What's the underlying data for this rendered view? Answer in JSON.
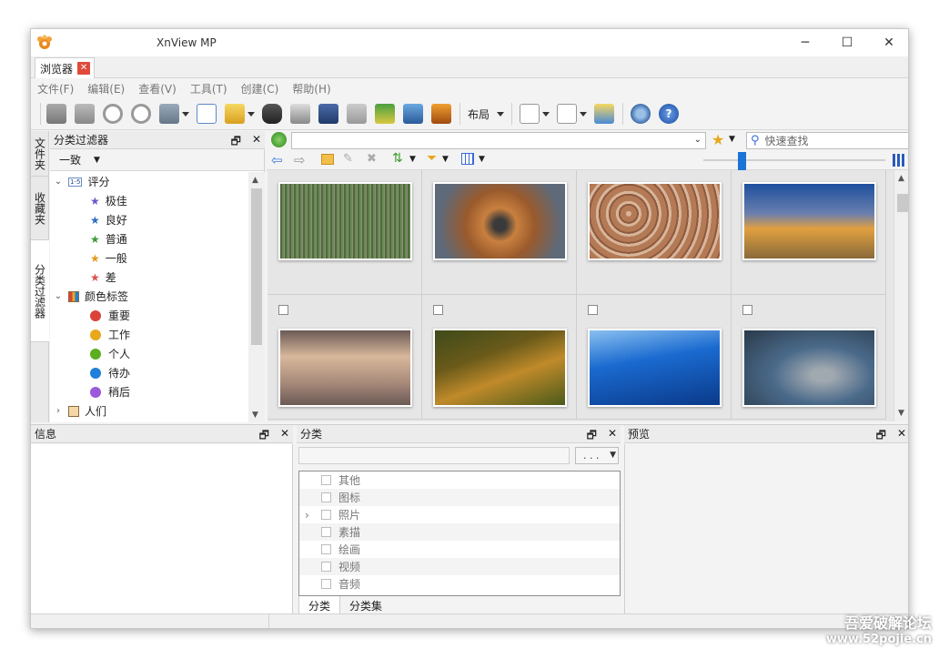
{
  "window": {
    "title": "XnView MP",
    "controls": {
      "minimize": "─",
      "maximize": "☐",
      "close": "✕"
    }
  },
  "tab": {
    "label": "浏览器",
    "close": "✕"
  },
  "menu": [
    {
      "label": "文件(F)"
    },
    {
      "label": "编辑(E)"
    },
    {
      "label": "查看(V)"
    },
    {
      "label": "工具(T)"
    },
    {
      "label": "创建(C)"
    },
    {
      "label": "帮助(H)"
    }
  ],
  "toolbar": {
    "layout_label": "布局"
  },
  "vtabs": {
    "folders": "文件夹",
    "favorites": "收藏夹",
    "filter": "分类过滤器"
  },
  "filter_panel": {
    "title": "分类过滤器",
    "float": "🗗",
    "close": "✕",
    "mode": "一致",
    "tree": {
      "rating": {
        "label": "评分",
        "icon_text": "1-5",
        "items": [
          {
            "label": "极佳",
            "color": "#6a5acd"
          },
          {
            "label": "良好",
            "color": "#2f6fc2"
          },
          {
            "label": "普通",
            "color": "#3a9a3a"
          },
          {
            "label": "一般",
            "color": "#e69a1e"
          },
          {
            "label": "差",
            "color": "#d9534f"
          }
        ]
      },
      "color_labels": {
        "label": "颜色标签",
        "items": [
          {
            "label": "重要",
            "color": "#d9433a"
          },
          {
            "label": "工作",
            "color": "#e8a81c"
          },
          {
            "label": "个人",
            "color": "#5cae1f"
          },
          {
            "label": "待办",
            "color": "#1f7fd9"
          },
          {
            "label": "稍后",
            "color": "#9a5ad9"
          }
        ]
      },
      "people": {
        "label": "人们"
      }
    }
  },
  "search": {
    "placeholder": "快速查找"
  },
  "thumbnails": [
    {
      "name": "grass-field",
      "colors": [
        "#5b7a4a",
        "#8f8a7a",
        "#4e6b3b"
      ]
    },
    {
      "name": "bat-eared-fox",
      "colors": [
        "#c9803f",
        "#5e6a7a",
        "#9a5a2c"
      ]
    },
    {
      "name": "cracked-clay",
      "colors": [
        "#b37a55",
        "#d8b59a",
        "#8e5a3e"
      ]
    },
    {
      "name": "brooklyn-bridge",
      "colors": [
        "#1f4f9e",
        "#e0a040",
        "#6a7fae"
      ]
    },
    {
      "name": "beach-sunset",
      "colors": [
        "#d8b89c",
        "#6b5a55",
        "#a88a7a"
      ]
    },
    {
      "name": "vineyard-hills",
      "colors": [
        "#6a5a1a",
        "#c08a2a",
        "#3e4a1a"
      ]
    },
    {
      "name": "blue-ice-cave",
      "colors": [
        "#1a6ad0",
        "#8ac0f0",
        "#0a3a8a"
      ]
    },
    {
      "name": "deer-in-snow",
      "colors": [
        "#4a6a8a",
        "#a0a8b0",
        "#2a3a4a"
      ]
    }
  ],
  "info_panel": {
    "title": "信息",
    "float": "🗗",
    "close": "✕"
  },
  "category_panel": {
    "title": "分类",
    "float": "🗗",
    "close": "✕",
    "dots": ". . .",
    "items": [
      {
        "label": "其他"
      },
      {
        "label": "图标"
      },
      {
        "label": "照片",
        "expandable": true
      },
      {
        "label": "素描"
      },
      {
        "label": "绘画"
      },
      {
        "label": "视频"
      },
      {
        "label": "音频"
      }
    ],
    "tabs": {
      "category": "分类",
      "category_set": "分类集"
    }
  },
  "preview_panel": {
    "title": "预览",
    "float": "🗗",
    "close": "✕"
  },
  "watermark": {
    "line1": "吾爱破解论坛",
    "line2": "www.52pojie.cn"
  }
}
